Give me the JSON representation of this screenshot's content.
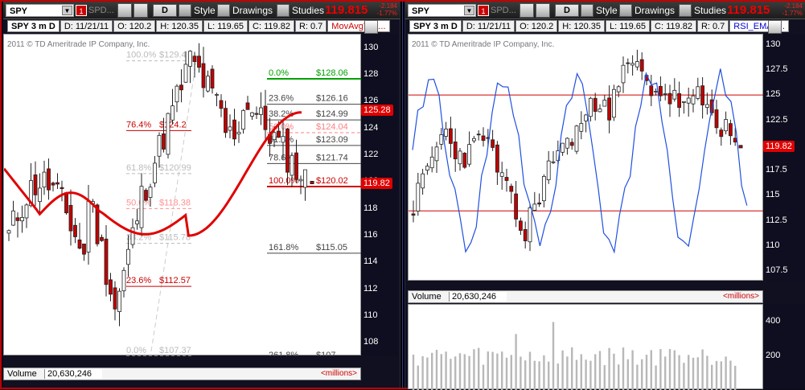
{
  "left": {
    "toolbar": {
      "symbol": "SPY",
      "ticker_mini": "SPD...",
      "aggregation": "D",
      "style_label": "Style",
      "drawings_label": "Drawings",
      "studies_label": "Studies",
      "last_price": "119.815",
      "change": "-2.184",
      "change_pct": "-1.77%"
    },
    "info_bar": {
      "name": "SPY 3 m D",
      "date": "D: 11/21/11",
      "open": "O: 120.2",
      "high": "H: 120.35",
      "low": "L: 119.65",
      "close": "C: 119.82",
      "range": "R: 0.7",
      "indicator": "MovAvgTria..."
    },
    "copyright": "2011 © TD Ameritrade IP Company, Inc.",
    "price_axis": [
      "130",
      "128",
      "126",
      "124",
      "122",
      "120",
      "118",
      "116",
      "114",
      "112",
      "110",
      "108"
    ],
    "price_marker_ma": "125.28",
    "price_marker_last": "119.82",
    "colors": {
      "accent": "#cc0000",
      "fib_green": "#00cc00",
      "ma_line": "#e00000",
      "marker_red": "#e00000"
    },
    "fib_right": [
      {
        "pct": "0.0%",
        "price": "$128.06",
        "color": "#00a000"
      },
      {
        "pct": "23.6%",
        "price": "$126.16",
        "color": "#444444"
      },
      {
        "pct": "38.2%",
        "price": "$124.99",
        "color": "#444444"
      },
      {
        "pct": "50.0%",
        "price": "$124.04",
        "color": "#ff8080"
      },
      {
        "pct": "61.8%",
        "price": "$123.09",
        "color": "#444444"
      },
      {
        "pct": "78.6%",
        "price": "$121.74",
        "color": "#444444"
      },
      {
        "pct": "100.0%",
        "price": "$120.02",
        "color": "#cc0000"
      },
      {
        "pct": "161.8%",
        "price": "$115.05",
        "color": "#444444"
      },
      {
        "pct": "261.8%",
        "price": "$107",
        "color": "#444444"
      }
    ],
    "fib_left": [
      {
        "pct": "100.0%",
        "price": "$129.4",
        "color": "#bbbbbb"
      },
      {
        "pct": "76.4%",
        "price": "$124.2",
        "color": "#cc0000"
      },
      {
        "pct": "61.8%",
        "price": "$120.99",
        "color": "#bbbbbb"
      },
      {
        "pct": "50.0%",
        "price": "$118.38",
        "color": "#ff9090"
      },
      {
        "pct": "38.2%",
        "price": "$115.78",
        "color": "#bbbbbb"
      },
      {
        "pct": "23.6%",
        "price": "$112.57",
        "color": "#cc0000"
      },
      {
        "pct": "0.0%",
        "price": "$107.37",
        "color": "#bbbbbb"
      }
    ],
    "volume": {
      "label": "Volume",
      "value": "20,630,246",
      "unit": "<millions>"
    }
  },
  "right": {
    "toolbar": {
      "symbol": "SPY",
      "ticker_mini": "SPD...",
      "aggregation": "D",
      "style_label": "Style",
      "drawings_label": "Drawings",
      "studies_label": "Studies",
      "last_price": "119.815",
      "change": "-2.184",
      "change_pct": "-1.77%"
    },
    "info_bar": {
      "name": "SPY 3 m D",
      "date": "D: 11/21/11",
      "open": "O: 120.2",
      "high": "H: 120.35",
      "low": "L: 119.65",
      "close": "C: 119.82",
      "range": "R: 0.7",
      "indicator": "RSI_EMA (..."
    },
    "copyright": "2011 © TD Ameritrade IP Company, Inc.",
    "price_axis": [
      "130",
      "127.5",
      "125",
      "122.5",
      "120",
      "117.5",
      "115",
      "112.5",
      "110",
      "107.5"
    ],
    "price_marker_last": "119.82",
    "volume": {
      "label": "Volume",
      "value": "20,630,246",
      "unit": "<millions>",
      "axis": [
        "400",
        "200"
      ]
    }
  }
}
